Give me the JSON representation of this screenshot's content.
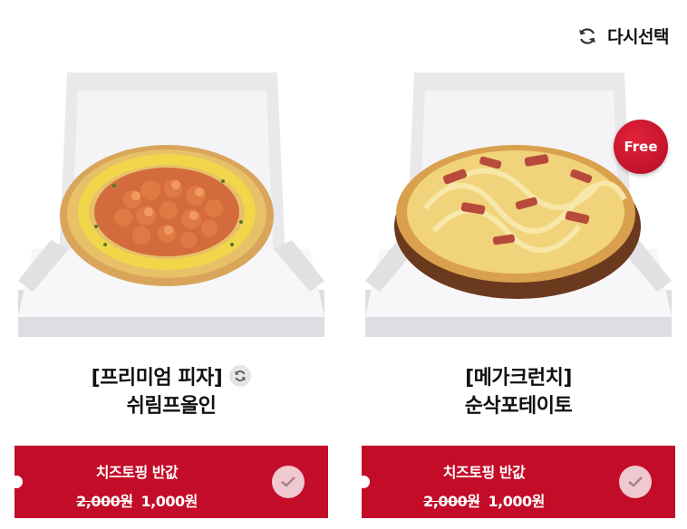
{
  "header": {
    "reselect_label": "다시선택",
    "reselect_icon": "refresh-icon"
  },
  "cards": [
    {
      "title_line1": "[프리미엄 피자]",
      "title_line2": "쉬림프올인",
      "has_swap_icon": true,
      "option": {
        "name": "치즈토핑 반값",
        "old_price": "2,000원",
        "new_price": "1,000원",
        "selected": true
      }
    },
    {
      "title_line1": "[메가크런치]",
      "title_line2": "순삭포테이토",
      "badge": "Free",
      "option": {
        "name": "치즈토핑 반값",
        "old_price": "2,000원",
        "new_price": "1,000원",
        "selected": true
      }
    }
  ],
  "colors": {
    "accent_red": "#c30c28",
    "check_bg": "#f0c8cf"
  }
}
